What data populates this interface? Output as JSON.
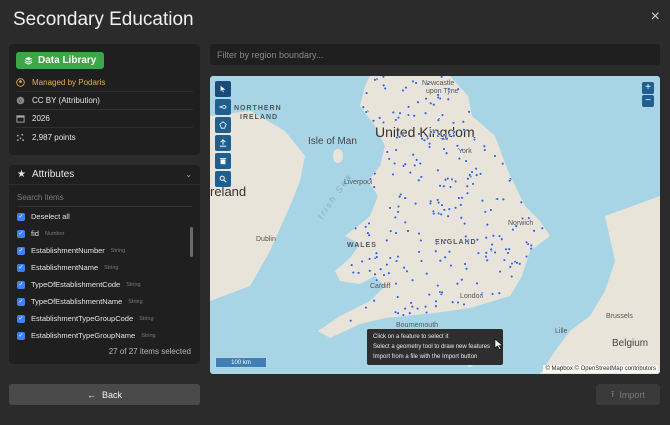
{
  "page": {
    "title": "Secondary Education",
    "close_glyph": "×"
  },
  "library": {
    "button_label": "Data Library",
    "managed_by": "Managed by Podaris",
    "license": "CC BY (Attribution)",
    "year": "2026",
    "points": "2,987 points"
  },
  "attributes": {
    "heading": "Attributes",
    "search_placeholder": "Search items",
    "deselect_label": "Deselect all",
    "items": [
      {
        "name": "fid",
        "type": "Number"
      },
      {
        "name": "EstablishmentNumber",
        "type": "String"
      },
      {
        "name": "EstablishmentName",
        "type": "String"
      },
      {
        "name": "TypeOfEstablishmentCode",
        "type": "String"
      },
      {
        "name": "TypeOfEstablishmentName",
        "type": "String"
      },
      {
        "name": "EstablishmentTypeGroupCode",
        "type": "String"
      },
      {
        "name": "EstablishmentTypeGroupName",
        "type": "String"
      }
    ],
    "count_label": "27 of 27 items selected"
  },
  "filter": {
    "placeholder": "Filter by region boundary..."
  },
  "map": {
    "labels": {
      "uk": "United Kingdom",
      "ireland": "reland",
      "northern": "NORTHERN",
      "ireland_caps": "IRELAND",
      "isle_of_man": "Isle of Man",
      "irish_sea": "Irish Sea",
      "wales": "WALES",
      "england": "ENGLAND",
      "newcastle": "Newcastle",
      "upon_tyne": "upon Tyne",
      "liverpool": "Liverpool",
      "dublin": "Dublin",
      "york": "York",
      "cardiff": "Cardiff",
      "london": "London",
      "bournemouth": "Bournemouth",
      "brussels": "Brussels",
      "belgium": "Belgium",
      "lille": "Lille",
      "norwich": "Norwich"
    },
    "scale_label": "100 km",
    "attribution": "© Mapbox © OpenStreetMap contributors",
    "zoom_in": "+",
    "zoom_out": "−",
    "tooltip": [
      "Click on a feature to select it",
      "Select a geometry tool to draw new features",
      "Import from a file with the Import button"
    ],
    "colors": {
      "water": "#a8d5e6",
      "land": "#e9e4d9",
      "point": "#3b64d6"
    }
  },
  "footer": {
    "back_label": "Back",
    "import_label": "Import"
  }
}
